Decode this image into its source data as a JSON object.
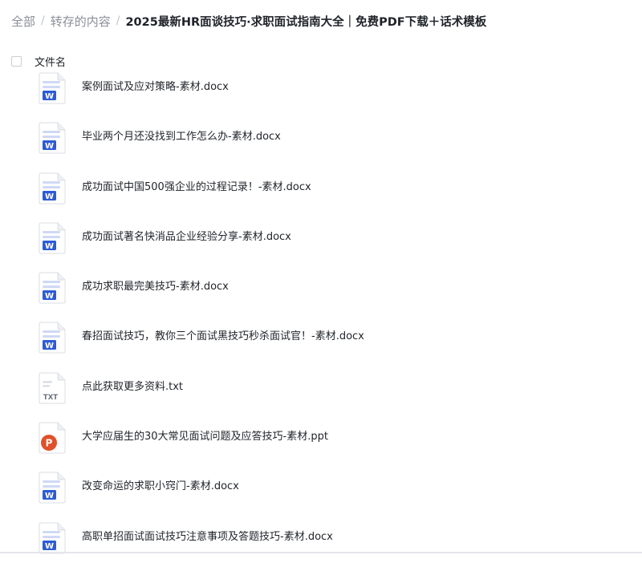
{
  "breadcrumb": {
    "items": [
      "全部",
      "转存的内容"
    ],
    "separator": "/",
    "current": "2025最新HR面谈技巧·求职面试指南大全｜免费PDF下载＋话术模板"
  },
  "list_header": {
    "column_label": "文件名"
  },
  "files": [
    {
      "name": "案例面试及应对策略-素材.docx",
      "type": "docx"
    },
    {
      "name": "毕业两个月还没找到工作怎么办-素材.docx",
      "type": "docx"
    },
    {
      "name": "成功面试中国500强企业的过程记录！-素材.docx",
      "type": "docx"
    },
    {
      "name": "成功面试著名快消品企业经验分享-素材.docx",
      "type": "docx"
    },
    {
      "name": "成功求职最完美技巧-素材.docx",
      "type": "docx"
    },
    {
      "name": "春招面试技巧，教你三个面试黑技巧秒杀面试官！-素材.docx",
      "type": "docx"
    },
    {
      "name": "点此获取更多资料.txt",
      "type": "txt"
    },
    {
      "name": "大学应届生的30大常见面试问题及应答技巧-素材.ppt",
      "type": "ppt"
    },
    {
      "name": "改变命运的求职小窍门-素材.docx",
      "type": "docx"
    },
    {
      "name": "高职单招面试面试技巧注意事项及答题技巧-素材.docx",
      "type": "docx"
    }
  ],
  "icon_labels": {
    "docx": "W",
    "txt": "TXT",
    "ppt": "P"
  },
  "colors": {
    "docx": "#2b5bd7",
    "txt": "#8a8f99",
    "ppt": "#e0512b"
  }
}
